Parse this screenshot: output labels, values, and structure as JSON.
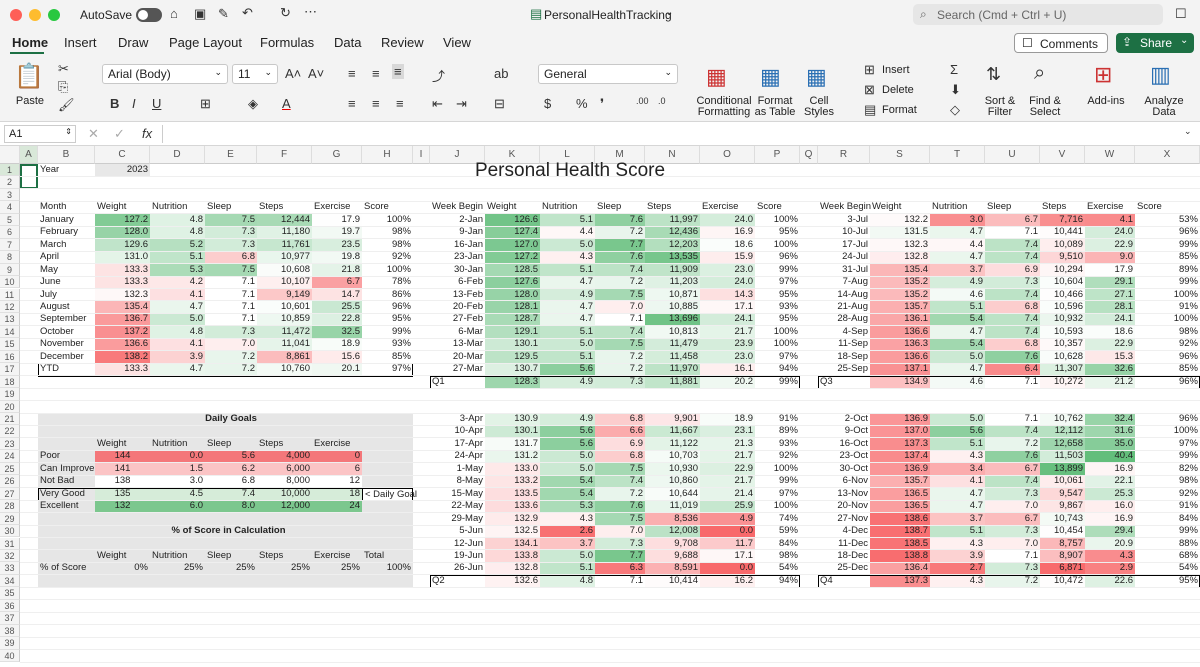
{
  "window": {
    "autosave": "AutoSave",
    "title": "PersonalHealthTracking",
    "search_placeholder": "Search (Cmd + Ctrl + U)"
  },
  "tabs": [
    "Home",
    "Insert",
    "Draw",
    "Page Layout",
    "Formulas",
    "Data",
    "Review",
    "View"
  ],
  "actions": {
    "comments": "Comments",
    "share": "Share"
  },
  "ribbon": {
    "paste": "Paste",
    "font": "Arial (Body)",
    "size": "11",
    "format": "General",
    "cond": "Conditional",
    "cond2": "Formatting",
    "fmt_table": "Format",
    "fmt_table2": "as Table",
    "cell_styles": "Cell",
    "cell_styles2": "Styles",
    "insert": "Insert",
    "delete": "Delete",
    "format_cells": "Format",
    "sort": "Sort &",
    "sort2": "Filter",
    "find": "Find &",
    "find2": "Select",
    "addins": "Add-ins",
    "analyze": "Analyze",
    "analyze2": "Data"
  },
  "formula": {
    "cellref": "A1",
    "fx": "fx"
  },
  "columns": [
    "A",
    "B",
    "C",
    "D",
    "E",
    "F",
    "G",
    "H",
    "I",
    "J",
    "K",
    "L",
    "M",
    "N",
    "O",
    "P",
    "Q",
    "R",
    "S",
    "T",
    "U",
    "V",
    "W",
    "X"
  ],
  "colors": {
    "green": "#63be7b",
    "red": "#f8696b",
    "white": "#ffffff"
  },
  "sheet": {
    "title": "Personal Health Score",
    "year_label": "Year",
    "year": "2023",
    "headers": [
      "Month",
      "Weight",
      "Nutrition",
      "Sleep",
      "Steps",
      "Exercise",
      "Score"
    ],
    "week_headers": [
      "Week Begin",
      "Weight",
      "Nutrition",
      "Sleep",
      "Steps",
      "Exercise",
      "Score"
    ],
    "months": [
      [
        "January",
        "127.2",
        "4.8",
        "7.5",
        "12,444",
        "17.9",
        "100%"
      ],
      [
        "February",
        "128.0",
        "4.8",
        "7.3",
        "11,180",
        "19.7",
        "98%"
      ],
      [
        "March",
        "129.6",
        "5.2",
        "7.3",
        "11,761",
        "23.5",
        "98%"
      ],
      [
        "April",
        "131.0",
        "5.1",
        "6.8",
        "10,977",
        "19.8",
        "92%"
      ],
      [
        "May",
        "133.3",
        "5.3",
        "7.5",
        "10,608",
        "21.8",
        "100%"
      ],
      [
        "June",
        "133.3",
        "4.2",
        "7.1",
        "10,107",
        "6.7",
        "78%"
      ],
      [
        "July",
        "132.3",
        "4.1",
        "7.1",
        "9,149",
        "14.7",
        "86%"
      ],
      [
        "August",
        "135.4",
        "4.7",
        "7.1",
        "10,601",
        "25.5",
        "96%"
      ],
      [
        "September",
        "136.7",
        "5.0",
        "7.1",
        "10,859",
        "22.8",
        "95%"
      ],
      [
        "October",
        "137.2",
        "4.8",
        "7.3",
        "11,472",
        "32.5",
        "99%"
      ],
      [
        "November",
        "136.6",
        "4.1",
        "7.0",
        "11,041",
        "18.9",
        "93%"
      ],
      [
        "December",
        "138.2",
        "3.9",
        "7.2",
        "8,861",
        "15.6",
        "85%"
      ]
    ],
    "ytd": [
      "YTD",
      "133.3",
      "4.7",
      "7.2",
      "10,760",
      "20.1",
      "97%"
    ],
    "q1": [
      [
        "2-Jan",
        "126.6",
        "5.1",
        "7.6",
        "11,997",
        "24.0",
        "100%"
      ],
      [
        "9-Jan",
        "127.4",
        "4.4",
        "7.2",
        "12,436",
        "16.9",
        "95%"
      ],
      [
        "16-Jan",
        "127.0",
        "5.0",
        "7.7",
        "12,203",
        "18.6",
        "100%"
      ],
      [
        "23-Jan",
        "127.2",
        "4.3",
        "7.6",
        "13,535",
        "15.9",
        "96%"
      ],
      [
        "30-Jan",
        "128.5",
        "5.1",
        "7.4",
        "11,909",
        "23.0",
        "99%"
      ],
      [
        "6-Feb",
        "127.6",
        "4.7",
        "7.2",
        "11,203",
        "24.0",
        "97%"
      ],
      [
        "13-Feb",
        "128.0",
        "4.9",
        "7.5",
        "10,871",
        "14.3",
        "95%"
      ],
      [
        "20-Feb",
        "128.1",
        "4.7",
        "7.0",
        "10,885",
        "17.1",
        "93%"
      ],
      [
        "27-Feb",
        "128.7",
        "4.7",
        "7.1",
        "13,696",
        "24.1",
        "95%"
      ],
      [
        "6-Mar",
        "129.1",
        "5.1",
        "7.4",
        "10,813",
        "21.7",
        "100%"
      ],
      [
        "13-Mar",
        "130.1",
        "5.0",
        "7.5",
        "11,479",
        "23.9",
        "100%"
      ],
      [
        "20-Mar",
        "129.5",
        "5.1",
        "7.2",
        "11,458",
        "23.0",
        "97%"
      ],
      [
        "27-Mar",
        "130.7",
        "5.6",
        "7.2",
        "11,970",
        "16.1",
        "94%"
      ]
    ],
    "q1_total": [
      "Q1",
      "128.3",
      "4.9",
      "7.3",
      "11,881",
      "20.2",
      "99%"
    ],
    "q2": [
      [
        "3-Apr",
        "130.9",
        "4.9",
        "6.8",
        "9,901",
        "18.9",
        "91%"
      ],
      [
        "10-Apr",
        "130.1",
        "5.6",
        "6.6",
        "11,667",
        "23.1",
        "89%"
      ],
      [
        "17-Apr",
        "131.7",
        "5.6",
        "6.9",
        "11,122",
        "21.3",
        "93%"
      ],
      [
        "24-Apr",
        "131.2",
        "5.0",
        "6.8",
        "10,703",
        "21.7",
        "92%"
      ],
      [
        "1-May",
        "133.0",
        "5.0",
        "7.5",
        "10,930",
        "22.9",
        "100%"
      ],
      [
        "8-May",
        "133.2",
        "5.4",
        "7.4",
        "10,860",
        "21.7",
        "99%"
      ],
      [
        "15-May",
        "133.5",
        "5.4",
        "7.2",
        "10,644",
        "21.4",
        "97%"
      ],
      [
        "22-May",
        "133.6",
        "5.3",
        "7.6",
        "11,019",
        "25.9",
        "100%"
      ],
      [
        "29-May",
        "132.9",
        "4.3",
        "7.5",
        "8,536",
        "4.9",
        "74%"
      ],
      [
        "5-Jun",
        "132.5",
        "2.6",
        "7.0",
        "12,008",
        "0.0",
        "59%"
      ],
      [
        "12-Jun",
        "134.1",
        "3.7",
        "7.3",
        "9,708",
        "11.7",
        "84%"
      ],
      [
        "19-Jun",
        "133.8",
        "5.0",
        "7.7",
        "9,688",
        "17.1",
        "98%"
      ],
      [
        "26-Jun",
        "132.8",
        "5.1",
        "6.3",
        "8,591",
        "0.0",
        "54%"
      ]
    ],
    "q2_total": [
      "Q2",
      "132.6",
      "4.8",
      "7.1",
      "10,414",
      "16.2",
      "94%"
    ],
    "q3": [
      [
        "3-Jul",
        "132.2",
        "3.0",
        "6.7",
        "7,716",
        "4.1",
        "53%"
      ],
      [
        "10-Jul",
        "131.5",
        "4.7",
        "7.1",
        "10,441",
        "24.0",
        "96%"
      ],
      [
        "17-Jul",
        "132.3",
        "4.4",
        "7.4",
        "10,089",
        "22.9",
        "99%"
      ],
      [
        "24-Jul",
        "132.8",
        "4.7",
        "7.4",
        "9,510",
        "9.0",
        "85%"
      ],
      [
        "31-Jul",
        "135.4",
        "3.7",
        "6.9",
        "10,294",
        "17.9",
        "89%"
      ],
      [
        "7-Aug",
        "135.2",
        "4.9",
        "7.3",
        "10,604",
        "29.1",
        "99%"
      ],
      [
        "14-Aug",
        "135.2",
        "4.6",
        "7.4",
        "10,466",
        "27.1",
        "100%"
      ],
      [
        "21-Aug",
        "135.7",
        "5.1",
        "6.8",
        "10,596",
        "28.1",
        "91%"
      ],
      [
        "28-Aug",
        "136.1",
        "5.4",
        "7.4",
        "10,932",
        "24.1",
        "100%"
      ],
      [
        "4-Sep",
        "136.6",
        "4.7",
        "7.4",
        "10,593",
        "18.6",
        "98%"
      ],
      [
        "11-Sep",
        "136.3",
        "5.4",
        "6.8",
        "10,357",
        "22.9",
        "92%"
      ],
      [
        "18-Sep",
        "136.6",
        "5.0",
        "7.6",
        "10,628",
        "15.3",
        "96%"
      ],
      [
        "25-Sep",
        "137.1",
        "4.7",
        "6.4",
        "11,307",
        "32.6",
        "85%"
      ]
    ],
    "q3_total": [
      "Q3",
      "134.9",
      "4.6",
      "7.1",
      "10,272",
      "21.2",
      "96%"
    ],
    "q4": [
      [
        "2-Oct",
        "136.9",
        "5.0",
        "7.1",
        "10,762",
        "32.4",
        "96%"
      ],
      [
        "9-Oct",
        "137.0",
        "5.6",
        "7.4",
        "12,112",
        "31.6",
        "100%"
      ],
      [
        "16-Oct",
        "137.3",
        "5.1",
        "7.2",
        "12,658",
        "35.0",
        "97%"
      ],
      [
        "23-Oct",
        "137.4",
        "4.3",
        "7.6",
        "11,503",
        "40.4",
        "99%"
      ],
      [
        "30-Oct",
        "136.9",
        "3.4",
        "6.7",
        "13,899",
        "16.9",
        "82%"
      ],
      [
        "6-Nov",
        "135.7",
        "4.1",
        "7.4",
        "10,061",
        "22.1",
        "98%"
      ],
      [
        "13-Nov",
        "136.5",
        "4.7",
        "7.3",
        "9,547",
        "25.3",
        "92%"
      ],
      [
        "20-Nov",
        "136.5",
        "4.7",
        "7.0",
        "9,867",
        "16.0",
        "91%"
      ],
      [
        "27-Nov",
        "138.6",
        "3.7",
        "6.7",
        "10,743",
        "16.9",
        "84%"
      ],
      [
        "4-Dec",
        "138.7",
        "5.1",
        "7.3",
        "10,454",
        "29.4",
        "99%"
      ],
      [
        "11-Dec",
        "138.5",
        "4.3",
        "7.0",
        "8,757",
        "20.9",
        "88%"
      ],
      [
        "18-Dec",
        "138.8",
        "3.9",
        "7.1",
        "8,907",
        "4.3",
        "68%"
      ],
      [
        "25-Dec",
        "136.4",
        "2.7",
        "7.3",
        "6,871",
        "2.9",
        "54%"
      ]
    ],
    "q4_total": [
      "Q4",
      "137.3",
      "4.3",
      "7.2",
      "10,472",
      "22.6",
      "95%"
    ],
    "goals_title": "Daily Goals",
    "goal_headers": [
      "Weight",
      "Nutrition",
      "Sleep",
      "Steps",
      "Exercise"
    ],
    "goals": [
      [
        "Poor",
        "144",
        "0.0",
        "5.6",
        "4,000",
        "0"
      ],
      [
        "Can Improve",
        "141",
        "1.5",
        "6.2",
        "6,000",
        "6"
      ],
      [
        "Not Bad",
        "138",
        "3.0",
        "6.8",
        "8,000",
        "12"
      ],
      [
        "Very Good",
        "135",
        "4.5",
        "7.4",
        "10,000",
        "18"
      ],
      [
        "Excellent",
        "132",
        "6.0",
        "8.0",
        "12,000",
        "24"
      ]
    ],
    "daily_goal_note": "< Daily Goal",
    "pct_title": "% of Score in Calculation",
    "pct_headers": [
      "Weight",
      "Nutrition",
      "Sleep",
      "Steps",
      "Exercise",
      "Total"
    ],
    "pct_row": [
      "% of Score",
      "0%",
      "25%",
      "25%",
      "25%",
      "25%",
      "100%"
    ]
  }
}
